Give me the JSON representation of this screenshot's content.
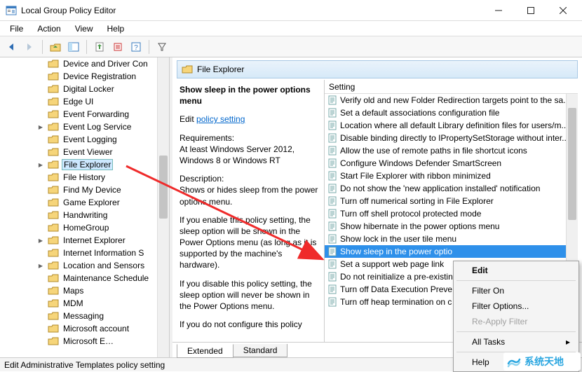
{
  "titlebar": {
    "title": "Local Group Policy Editor"
  },
  "menubar": [
    "File",
    "Action",
    "View",
    "Help"
  ],
  "tree": {
    "items": [
      {
        "label": "Device and Driver Con",
        "expand": ""
      },
      {
        "label": "Device Registration",
        "expand": ""
      },
      {
        "label": "Digital Locker",
        "expand": ""
      },
      {
        "label": "Edge UI",
        "expand": ""
      },
      {
        "label": "Event Forwarding",
        "expand": ""
      },
      {
        "label": "Event Log Service",
        "expand": ">"
      },
      {
        "label": "Event Logging",
        "expand": ""
      },
      {
        "label": "Event Viewer",
        "expand": ""
      },
      {
        "label": "File Explorer",
        "expand": ">",
        "selected": true
      },
      {
        "label": "File History",
        "expand": ""
      },
      {
        "label": "Find My Device",
        "expand": ""
      },
      {
        "label": "Game Explorer",
        "expand": ""
      },
      {
        "label": "Handwriting",
        "expand": ""
      },
      {
        "label": "HomeGroup",
        "expand": ""
      },
      {
        "label": "Internet Explorer",
        "expand": ">"
      },
      {
        "label": "Internet Information S",
        "expand": ""
      },
      {
        "label": "Location and Sensors",
        "expand": ">"
      },
      {
        "label": "Maintenance Schedule",
        "expand": ""
      },
      {
        "label": "Maps",
        "expand": ""
      },
      {
        "label": "MDM",
        "expand": ""
      },
      {
        "label": "Messaging",
        "expand": ""
      },
      {
        "label": "Microsoft account",
        "expand": ""
      },
      {
        "label": "Microsoft E…",
        "expand": ""
      }
    ]
  },
  "content": {
    "header": "File Explorer",
    "desc_title": "Show sleep in the power options menu",
    "edit_prefix": "Edit ",
    "edit_link": "policy setting",
    "req_label": "Requirements:",
    "req_text": "At least Windows Server 2012, Windows 8 or Windows RT",
    "d_label": "Description:",
    "d_text": "Shows or hides sleep from the power options menu.",
    "p1": "If you enable this policy setting, the sleep option will be shown in the Power Options menu (as long as it is supported by the machine's hardware).",
    "p2": "If you disable this policy setting, the sleep option will never be shown in the Power Options menu.",
    "p3": "If you do not configure this policy"
  },
  "list": {
    "header": "Setting",
    "rows": [
      "Verify old and new Folder Redirection targets point to the sa..",
      "Set a default associations configuration file",
      "Location where all default Library definition files for users/m...",
      "Disable binding directly to IPropertySetStorage without inter...",
      "Allow the use of remote paths in file shortcut icons",
      "Configure Windows Defender SmartScreen",
      "Start File Explorer with ribbon minimized",
      "Do not show the 'new application installed' notification",
      "Turn off numerical sorting in File Explorer",
      "Turn off shell protocol protected mode",
      "Show hibernate in the power options menu",
      "Show lock in the user tile menu",
      "Show sleep in the power optio",
      "Set a support web page link",
      "Do not reinitialize a pre-existin",
      "Turn off Data Execution Preve",
      "Turn off heap termination on c"
    ],
    "selected_index": 12
  },
  "tabs": {
    "extended": "Extended",
    "standard": "Standard"
  },
  "statusbar": "Edit Administrative Templates policy setting",
  "context_menu": {
    "items": [
      {
        "label": "Edit",
        "type": "default"
      },
      {
        "type": "sep"
      },
      {
        "label": "Filter On"
      },
      {
        "label": "Filter Options..."
      },
      {
        "label": "Re-Apply Filter",
        "type": "disabled"
      },
      {
        "type": "sep"
      },
      {
        "label": "All Tasks",
        "sub": true
      },
      {
        "type": "sep"
      },
      {
        "label": "Help"
      }
    ]
  },
  "watermark": "系统天地"
}
